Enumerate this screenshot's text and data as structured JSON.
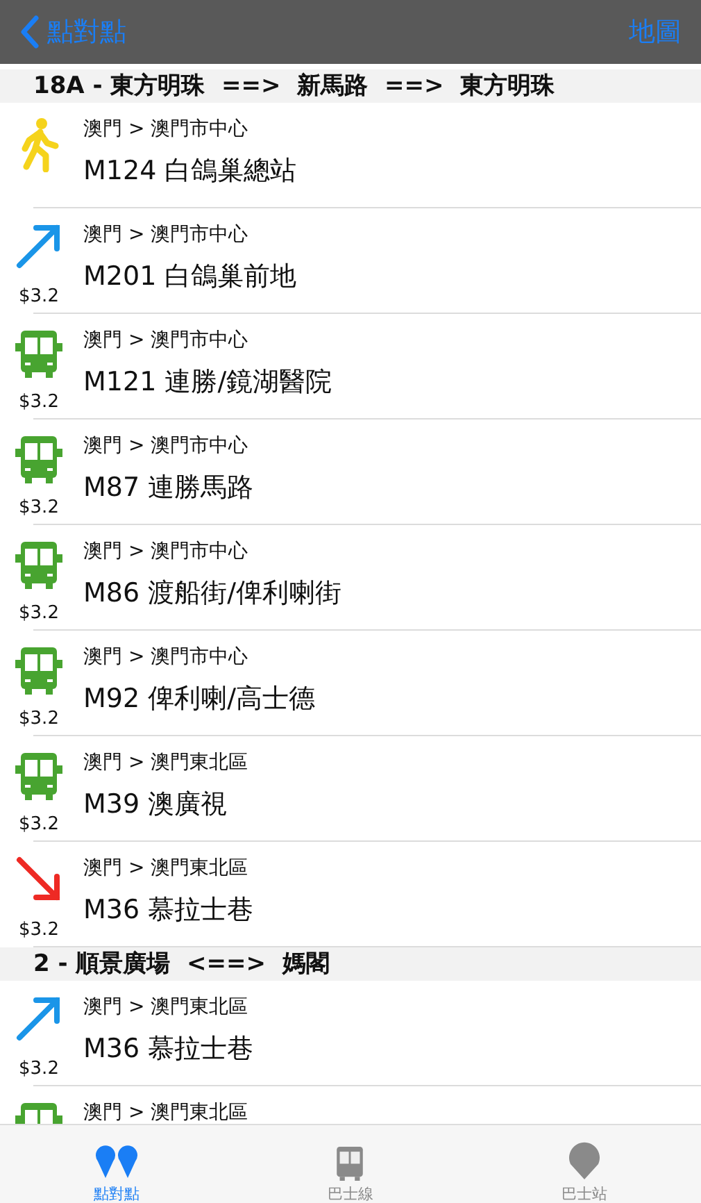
{
  "nav": {
    "back": "點對點",
    "action": "地圖"
  },
  "sections": [
    {
      "header": "18A - 東方明珠  ==>  新馬路  ==>  東方明珠",
      "rows": [
        {
          "kind": "walk",
          "area": "澳門 > 澳門市中心",
          "stop": "M124 白鴿巢總站"
        },
        {
          "kind": "board",
          "fare": "$3.2",
          "area": "澳門 > 澳門市中心",
          "stop": "M201 白鴿巢前地"
        },
        {
          "kind": "bus",
          "fare": "$3.2",
          "area": "澳門 > 澳門市中心",
          "stop": "M121 連勝/鏡湖醫院"
        },
        {
          "kind": "bus",
          "fare": "$3.2",
          "area": "澳門 > 澳門市中心",
          "stop": "M87 連勝馬路"
        },
        {
          "kind": "bus",
          "fare": "$3.2",
          "area": "澳門 > 澳門市中心",
          "stop": "M86 渡船街/俾利喇街"
        },
        {
          "kind": "bus",
          "fare": "$3.2",
          "area": "澳門 > 澳門市中心",
          "stop": "M92 俾利喇/高士德"
        },
        {
          "kind": "bus",
          "fare": "$3.2",
          "area": "澳門 > 澳門東北區",
          "stop": "M39 澳廣視"
        },
        {
          "kind": "alight",
          "fare": "$3.2",
          "area": "澳門 > 澳門東北區",
          "stop": "M36 慕拉士巷"
        }
      ]
    },
    {
      "header": "2 - 順景廣場  <==>  媽閣",
      "rows": [
        {
          "kind": "board",
          "fare": "$3.2",
          "area": "澳門 > 澳門東北區",
          "stop": "M36 慕拉士巷"
        },
        {
          "kind": "bus",
          "area": "澳門 > 澳門東北區"
        }
      ]
    }
  ],
  "tabs": [
    {
      "kind": "pins",
      "label": "點對點",
      "selected": true
    },
    {
      "kind": "bus",
      "label": "巴士線",
      "selected": false
    },
    {
      "kind": "pin",
      "label": "巴士站",
      "selected": false
    }
  ]
}
